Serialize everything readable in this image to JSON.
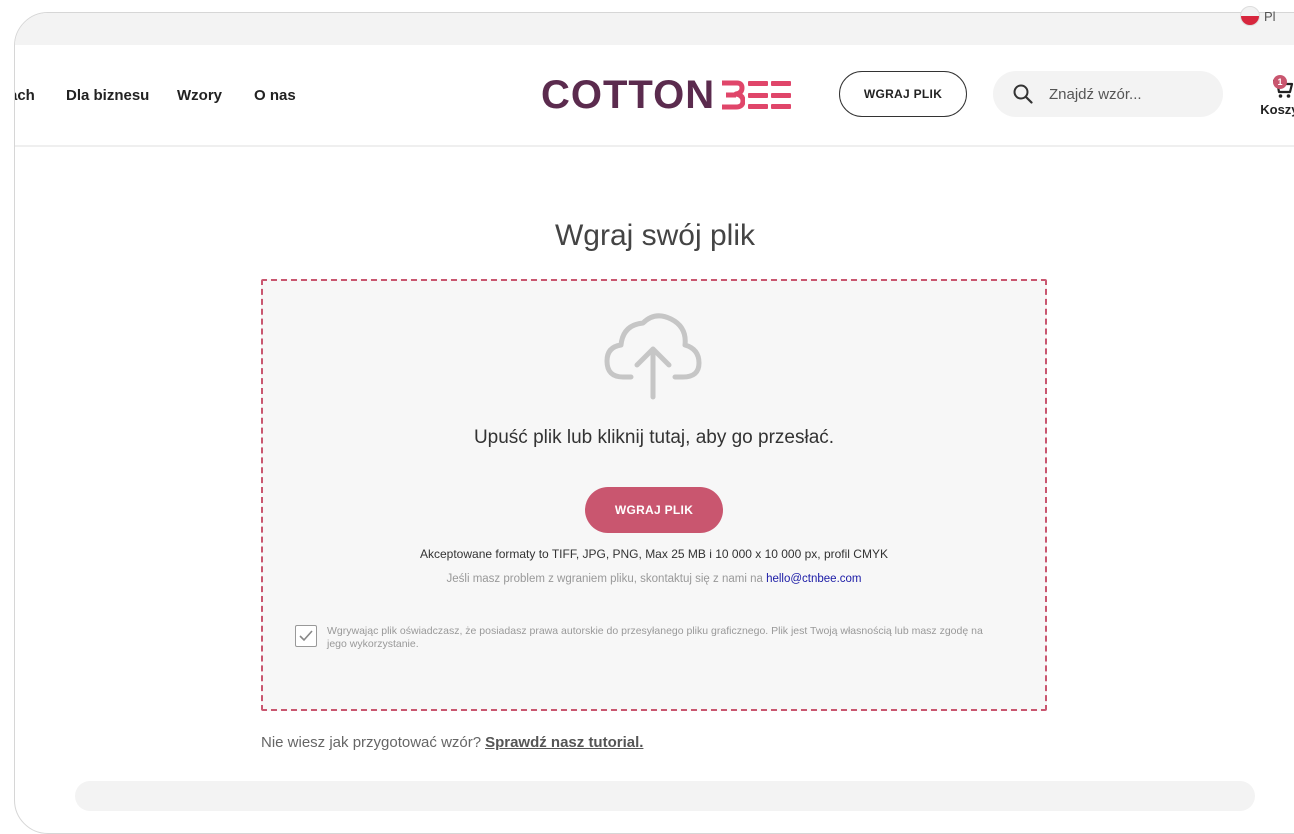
{
  "lang": {
    "label": "Pl"
  },
  "nav": {
    "items": [
      "ach",
      "Dla biznesu",
      "Wzory",
      "O nas"
    ]
  },
  "logo": {
    "part1": "COTTON",
    "part2": "B"
  },
  "header": {
    "upload_button": "WGRAJ PLIK",
    "search_placeholder": "Znajdź wzór...",
    "cart_label": "Koszyk",
    "cart_count": "1"
  },
  "main": {
    "title": "Wgraj swój plik",
    "drop_text": "Upuść plik lub kliknij tutaj, aby go przesłać.",
    "upload_button": "WGRAJ PLIK",
    "formats": "Akceptowane formaty to TIFF, JPG, PNG, Max 25 MB i 10 000 x 10 000 px, profil CMYK",
    "contact_prefix": "Jeśli masz problem z wgraniem pliku, skontaktuj się z nami na ",
    "contact_email": "hello@ctnbee.com",
    "consent": "Wgrywając plik oświadczasz, że posiadasz prawa autorskie do przesyłanego pliku graficznego. Plik jest Twoją własnością lub masz zgodę na jego wykorzystanie.",
    "consent_checked": true,
    "tutorial_prefix": "Nie wiesz jak przygotować wzór?",
    "tutorial_link": "Sprawdź nasz tutorial."
  },
  "colors": {
    "accent": "#c9566f",
    "logo_dark": "#5b2b4e",
    "logo_pink": "#e0466a"
  }
}
